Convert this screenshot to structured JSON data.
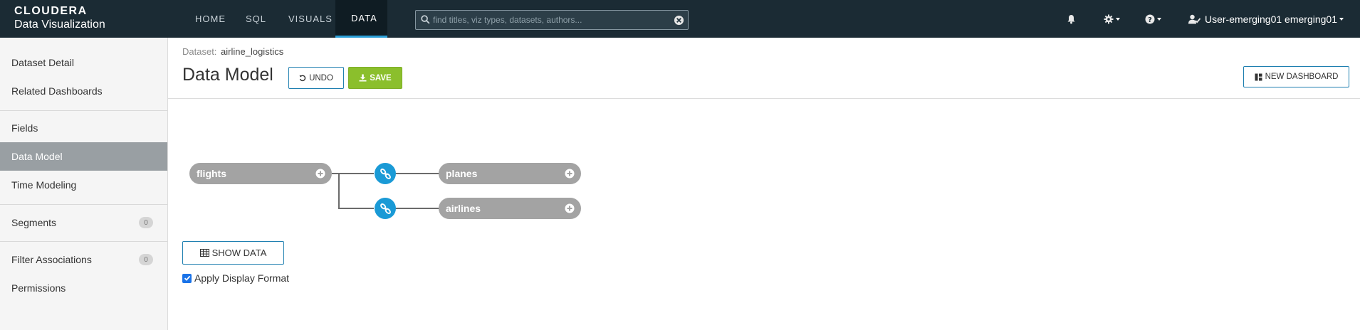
{
  "app": {
    "brand": "CLOUDERA",
    "product": "Data Visualization"
  },
  "nav": {
    "items": [
      "HOME",
      "SQL",
      "VISUALS",
      "DATA"
    ],
    "active": "DATA"
  },
  "search": {
    "placeholder": "find titles, viz types, datasets, authors...",
    "value": ""
  },
  "header_icons": [
    "bell-icon",
    "gear-icon",
    "help-icon",
    "user-icon"
  ],
  "user": {
    "label": "User-emerging01 emerging01"
  },
  "sidebar": {
    "items": [
      {
        "label": "Dataset Detail"
      },
      {
        "label": "Related Dashboards"
      },
      {
        "label": "Fields"
      },
      {
        "label": "Data Model"
      },
      {
        "label": "Time Modeling"
      },
      {
        "label": "Segments",
        "count": "0"
      },
      {
        "label": "Filter Associations",
        "count": "0"
      },
      {
        "label": "Permissions"
      }
    ],
    "active": "Data Model"
  },
  "breadcrumb": {
    "key": "Dataset:",
    "value": "airline_logistics"
  },
  "page": {
    "title": "Data Model",
    "undo_label": "UNDO",
    "save_label": "SAVE",
    "new_dashboard_label": "NEW DASHBOARD"
  },
  "model": {
    "primary_table": "flights",
    "joins": [
      {
        "table": "planes",
        "icon": "link-icon"
      },
      {
        "table": "airlines",
        "icon": "link-icon"
      }
    ]
  },
  "show_data_label": "SHOW DATA",
  "display_format": {
    "label": "Apply Display Format",
    "checked": true
  },
  "colors": {
    "topbar": "#1b2b34",
    "active_tab_underline": "#2a9fd8",
    "save_green": "#8bbf2c",
    "join_blue": "#1a9ad6",
    "pill_gray": "#a3a3a3",
    "sidebar_active": "#999fa3"
  }
}
